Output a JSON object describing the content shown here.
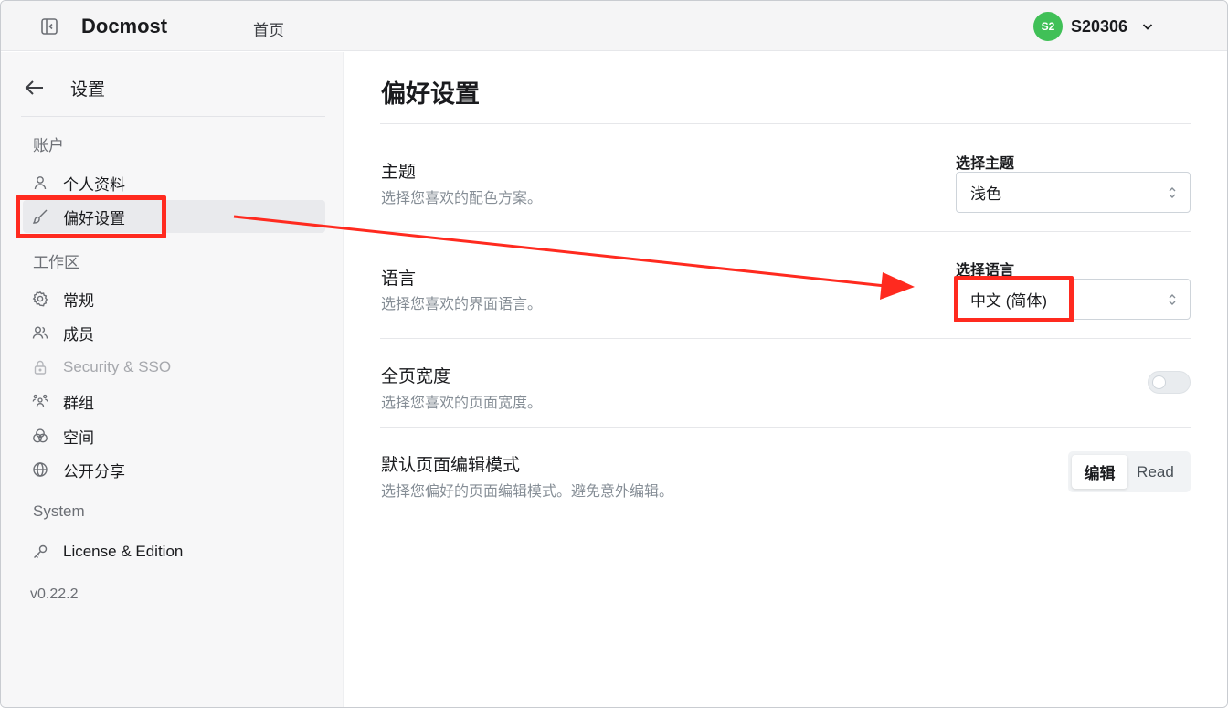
{
  "header": {
    "brand": "Docmost",
    "home_link": "首页",
    "user": {
      "initials": "S2",
      "name": "S20306",
      "avatar_color": "#40c057"
    }
  },
  "sidebar": {
    "back_title": "设置",
    "groups": [
      {
        "label": "账户",
        "items": [
          {
            "label": "个人资料",
            "icon": "user-icon"
          },
          {
            "label": "偏好设置",
            "icon": "brush-icon",
            "active": true
          }
        ]
      },
      {
        "label": "工作区",
        "items": [
          {
            "label": "常规",
            "icon": "settings-icon"
          },
          {
            "label": "成员",
            "icon": "users-icon"
          },
          {
            "label": "Security & SSO",
            "icon": "lock-icon",
            "disabled": true
          },
          {
            "label": "群组",
            "icon": "group-icon"
          },
          {
            "label": "空间",
            "icon": "spaces-icon"
          },
          {
            "label": "公开分享",
            "icon": "globe-icon"
          }
        ]
      },
      {
        "label": "System",
        "items": [
          {
            "label": "License & Edition",
            "icon": "key-icon"
          }
        ]
      }
    ],
    "version": "v0.22.2"
  },
  "main": {
    "title": "偏好设置",
    "theme": {
      "title": "主题",
      "desc": "选择您喜欢的配色方案。",
      "field_label": "选择主题",
      "value": "浅色"
    },
    "language": {
      "title": "语言",
      "desc": "选择您喜欢的界面语言。",
      "field_label": "选择语言",
      "value": "中文 (简体)"
    },
    "width": {
      "title": "全页宽度",
      "desc": "选择您喜欢的页面宽度。",
      "enabled": false
    },
    "edit_mode": {
      "title": "默认页面编辑模式",
      "desc": "选择您偏好的页面编辑模式。避免意外编辑。",
      "options": [
        "编辑",
        "Read"
      ],
      "selected": "编辑"
    }
  },
  "annotation_color": "#ff2a1f"
}
